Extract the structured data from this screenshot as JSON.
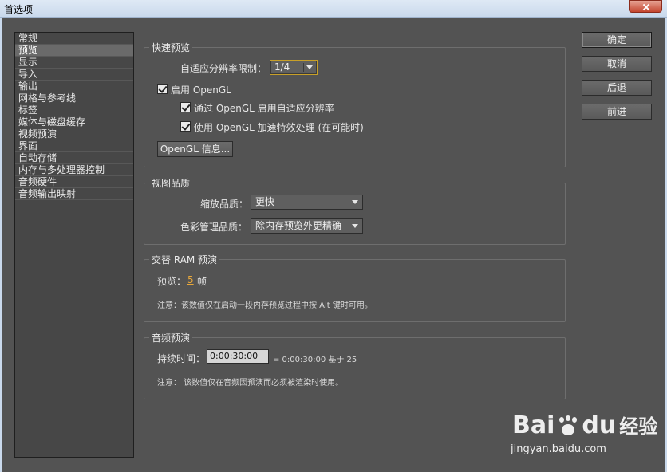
{
  "window": {
    "title": "首选项"
  },
  "categories": [
    "常规",
    "预览",
    "显示",
    "导入",
    "输出",
    "网格与参考线",
    "标签",
    "媒体与磁盘缓存",
    "视频预演",
    "界面",
    "自动存储",
    "内存与多处理器控制",
    "音频硬件",
    "音频输出映射"
  ],
  "selected_category": "预览",
  "fast_preview": {
    "title": "快速预览",
    "res_limit_label": "自适应分辨率限制：",
    "res_limit_value": "1/4",
    "enable_opengl_label": "启用 OpenGL",
    "adaptive_opengl_label": "通过 OpenGL 启用自适应分辨率",
    "effects_opengl_label": "使用 OpenGL 加速特效处理 (在可能时)",
    "opengl_info_button": "OpenGL 信息..."
  },
  "viewer_quality": {
    "title": "视图品质",
    "zoom_label": "缩放品质：",
    "zoom_value": "更快",
    "color_label": "色彩管理品质：",
    "color_value": "除内存预览外更精确"
  },
  "alt_ram": {
    "title": "交替 RAM 预演",
    "preview_label": "预览：",
    "preview_value": "5",
    "preview_unit": "帧",
    "note": "注意：该数值仅在启动一段内存预览过程中按 Alt 键时可用。"
  },
  "audio_preview": {
    "title": "音频预演",
    "duration_label": "持续时间：",
    "duration_value": "0:00:30:00",
    "duration_info": "= 0:00:30:00  基于 25",
    "note": "注意：  该数值仅在音频因预演而必须被渲染时使用。"
  },
  "buttons": {
    "ok": "确定",
    "cancel": "取消",
    "previous": "后退",
    "next": "前进"
  },
  "watermark": {
    "brand_left": "Bai",
    "brand_right": "du",
    "cn": "经验",
    "url": "jingyan.baidu.com"
  }
}
